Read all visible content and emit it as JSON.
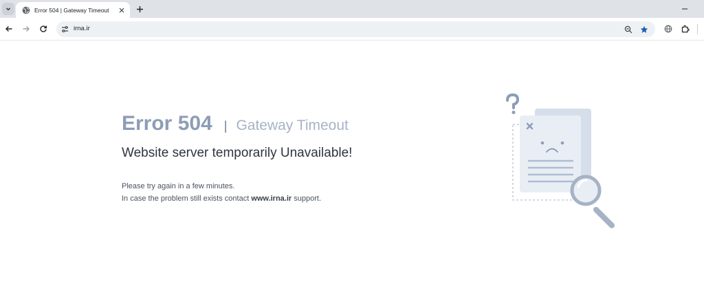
{
  "browser": {
    "tab": {
      "title": "Error 504 | Gateway Timeout",
      "favicon": "globe-icon"
    },
    "omnibox": {
      "url": "irna.ir"
    },
    "colors": {
      "tabbar": "#dfe3e8",
      "omnibox": "#eef1f4",
      "bookmark_star": "#1a5fb4"
    }
  },
  "page": {
    "code": "Error 504",
    "separator": "|",
    "name": "Gateway Timeout",
    "title": "Website server temporarily Unavailable!",
    "line1": "Please try again in a few minutes.",
    "line2_prefix": "In case the problem still exists contact",
    "line2_domain": "www.irna.ir",
    "line2_suffix": "support.",
    "illustration": "document-search-sad-illustration",
    "colors": {
      "code": "#8d9db6",
      "name": "#a6b3c6",
      "title": "#2e3440",
      "illustration": "#b9c6d8"
    }
  }
}
